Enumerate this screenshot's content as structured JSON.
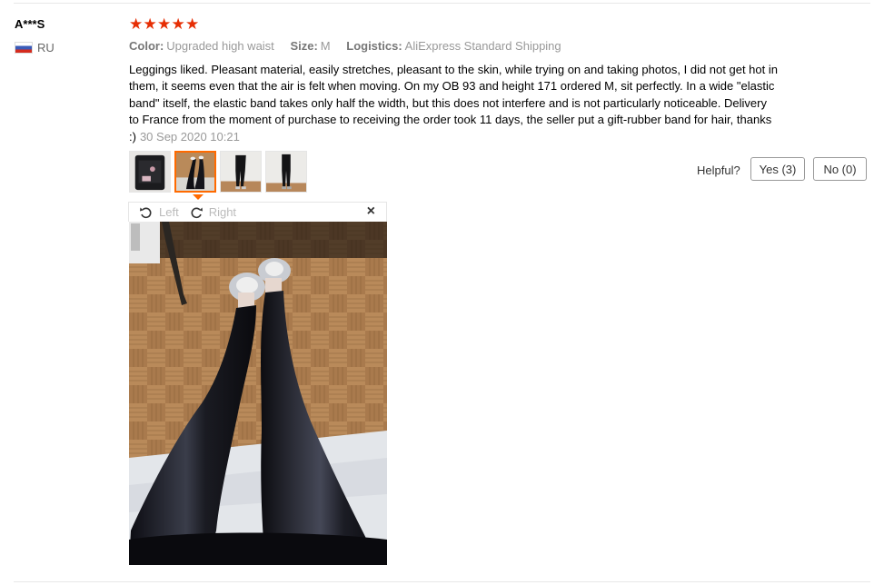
{
  "user": {
    "name": "A***S",
    "country_code": "RU",
    "flag_icon": "russia-flag-icon"
  },
  "rating": {
    "stars": 5,
    "max": 5,
    "color": "#e62e04"
  },
  "attributes": [
    {
      "key": "Color:",
      "value": "Upgraded high waist"
    },
    {
      "key": "Size:",
      "value": "M"
    },
    {
      "key": "Logistics:",
      "value": "AliExpress Standard Shipping"
    }
  ],
  "feedback": {
    "text": "Leggings liked. Pleasant material, easily stretches, pleasant to the skin, while trying on and taking photos, I did not get hot in them, it seems even that the air is felt when moving. On my OB 93 and height 171 ordered M, sit perfectly. In a wide \"elastic band\" itself, the elastic band takes only half the width, but this does not interfere and is not particularly noticeable. Delivery to France from the moment of purchase to receiving the order took 11 days, the seller put a gift-rubber band for hair, thanks :)",
    "date": "30 Sep 2020 10:21"
  },
  "photos": {
    "count": 4,
    "active_index": 1,
    "accent_color": "#ff6a00"
  },
  "viewer": {
    "rotate_left": "Left",
    "rotate_right": "Right",
    "close": "×"
  },
  "helpful": {
    "label": "Helpful?",
    "yes": "Yes (3)",
    "no": "No (0)"
  }
}
